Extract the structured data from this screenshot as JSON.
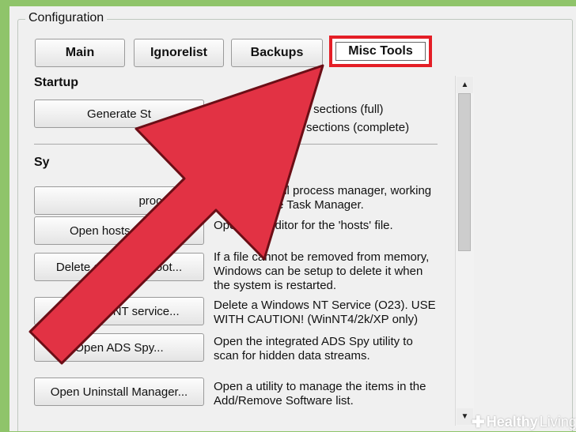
{
  "groupbox": {
    "title": "Configuration"
  },
  "tabs": [
    {
      "label": "Main"
    },
    {
      "label": "Ignorelist"
    },
    {
      "label": "Backups"
    },
    {
      "label": "Misc Tools",
      "active": true
    }
  ],
  "startup": {
    "title": "Startup",
    "generate_button": "Generate St",
    "options": [
      "o minor sections (full)",
      "empty sections (complete)"
    ]
  },
  "system": {
    "title": "Sy",
    "tools": [
      {
        "button": "process ma",
        "description": [
          "Opens a small process manager, working",
          "much like the Task Manager."
        ]
      },
      {
        "button": "Open hosts file ma",
        "description": [
          "Opens an editor for the 'hosts' file."
        ]
      },
      {
        "button": "Delete a file on reboot...",
        "description": [
          "If a file cannot be removed from memory,",
          "Windows can be setup to delete it when",
          "the system is restarted."
        ]
      },
      {
        "button": "Delete an NT service...",
        "description": [
          "Delete a Windows NT Service (O23). USE",
          "WITH CAUTION! (WinNT4/2k/XP only)"
        ]
      },
      {
        "button": "Open ADS Spy...",
        "description": [
          "Open the integrated ADS Spy utility to",
          "scan for hidden data streams."
        ]
      },
      {
        "button": "Open Uninstall Manager...",
        "description": [
          "Open a utility to manage the items in the",
          "Add/Remove Software list."
        ]
      }
    ]
  },
  "scrollbar": {
    "up_icon": "triangle-up",
    "down_icon": "triangle-down"
  },
  "watermark": {
    "brand_bold": "Healthy",
    "brand_light": "Living"
  },
  "colors": {
    "highlight_red": "#e41e26",
    "arrow_red": "#e23244",
    "background_green": "#8fc46a"
  }
}
